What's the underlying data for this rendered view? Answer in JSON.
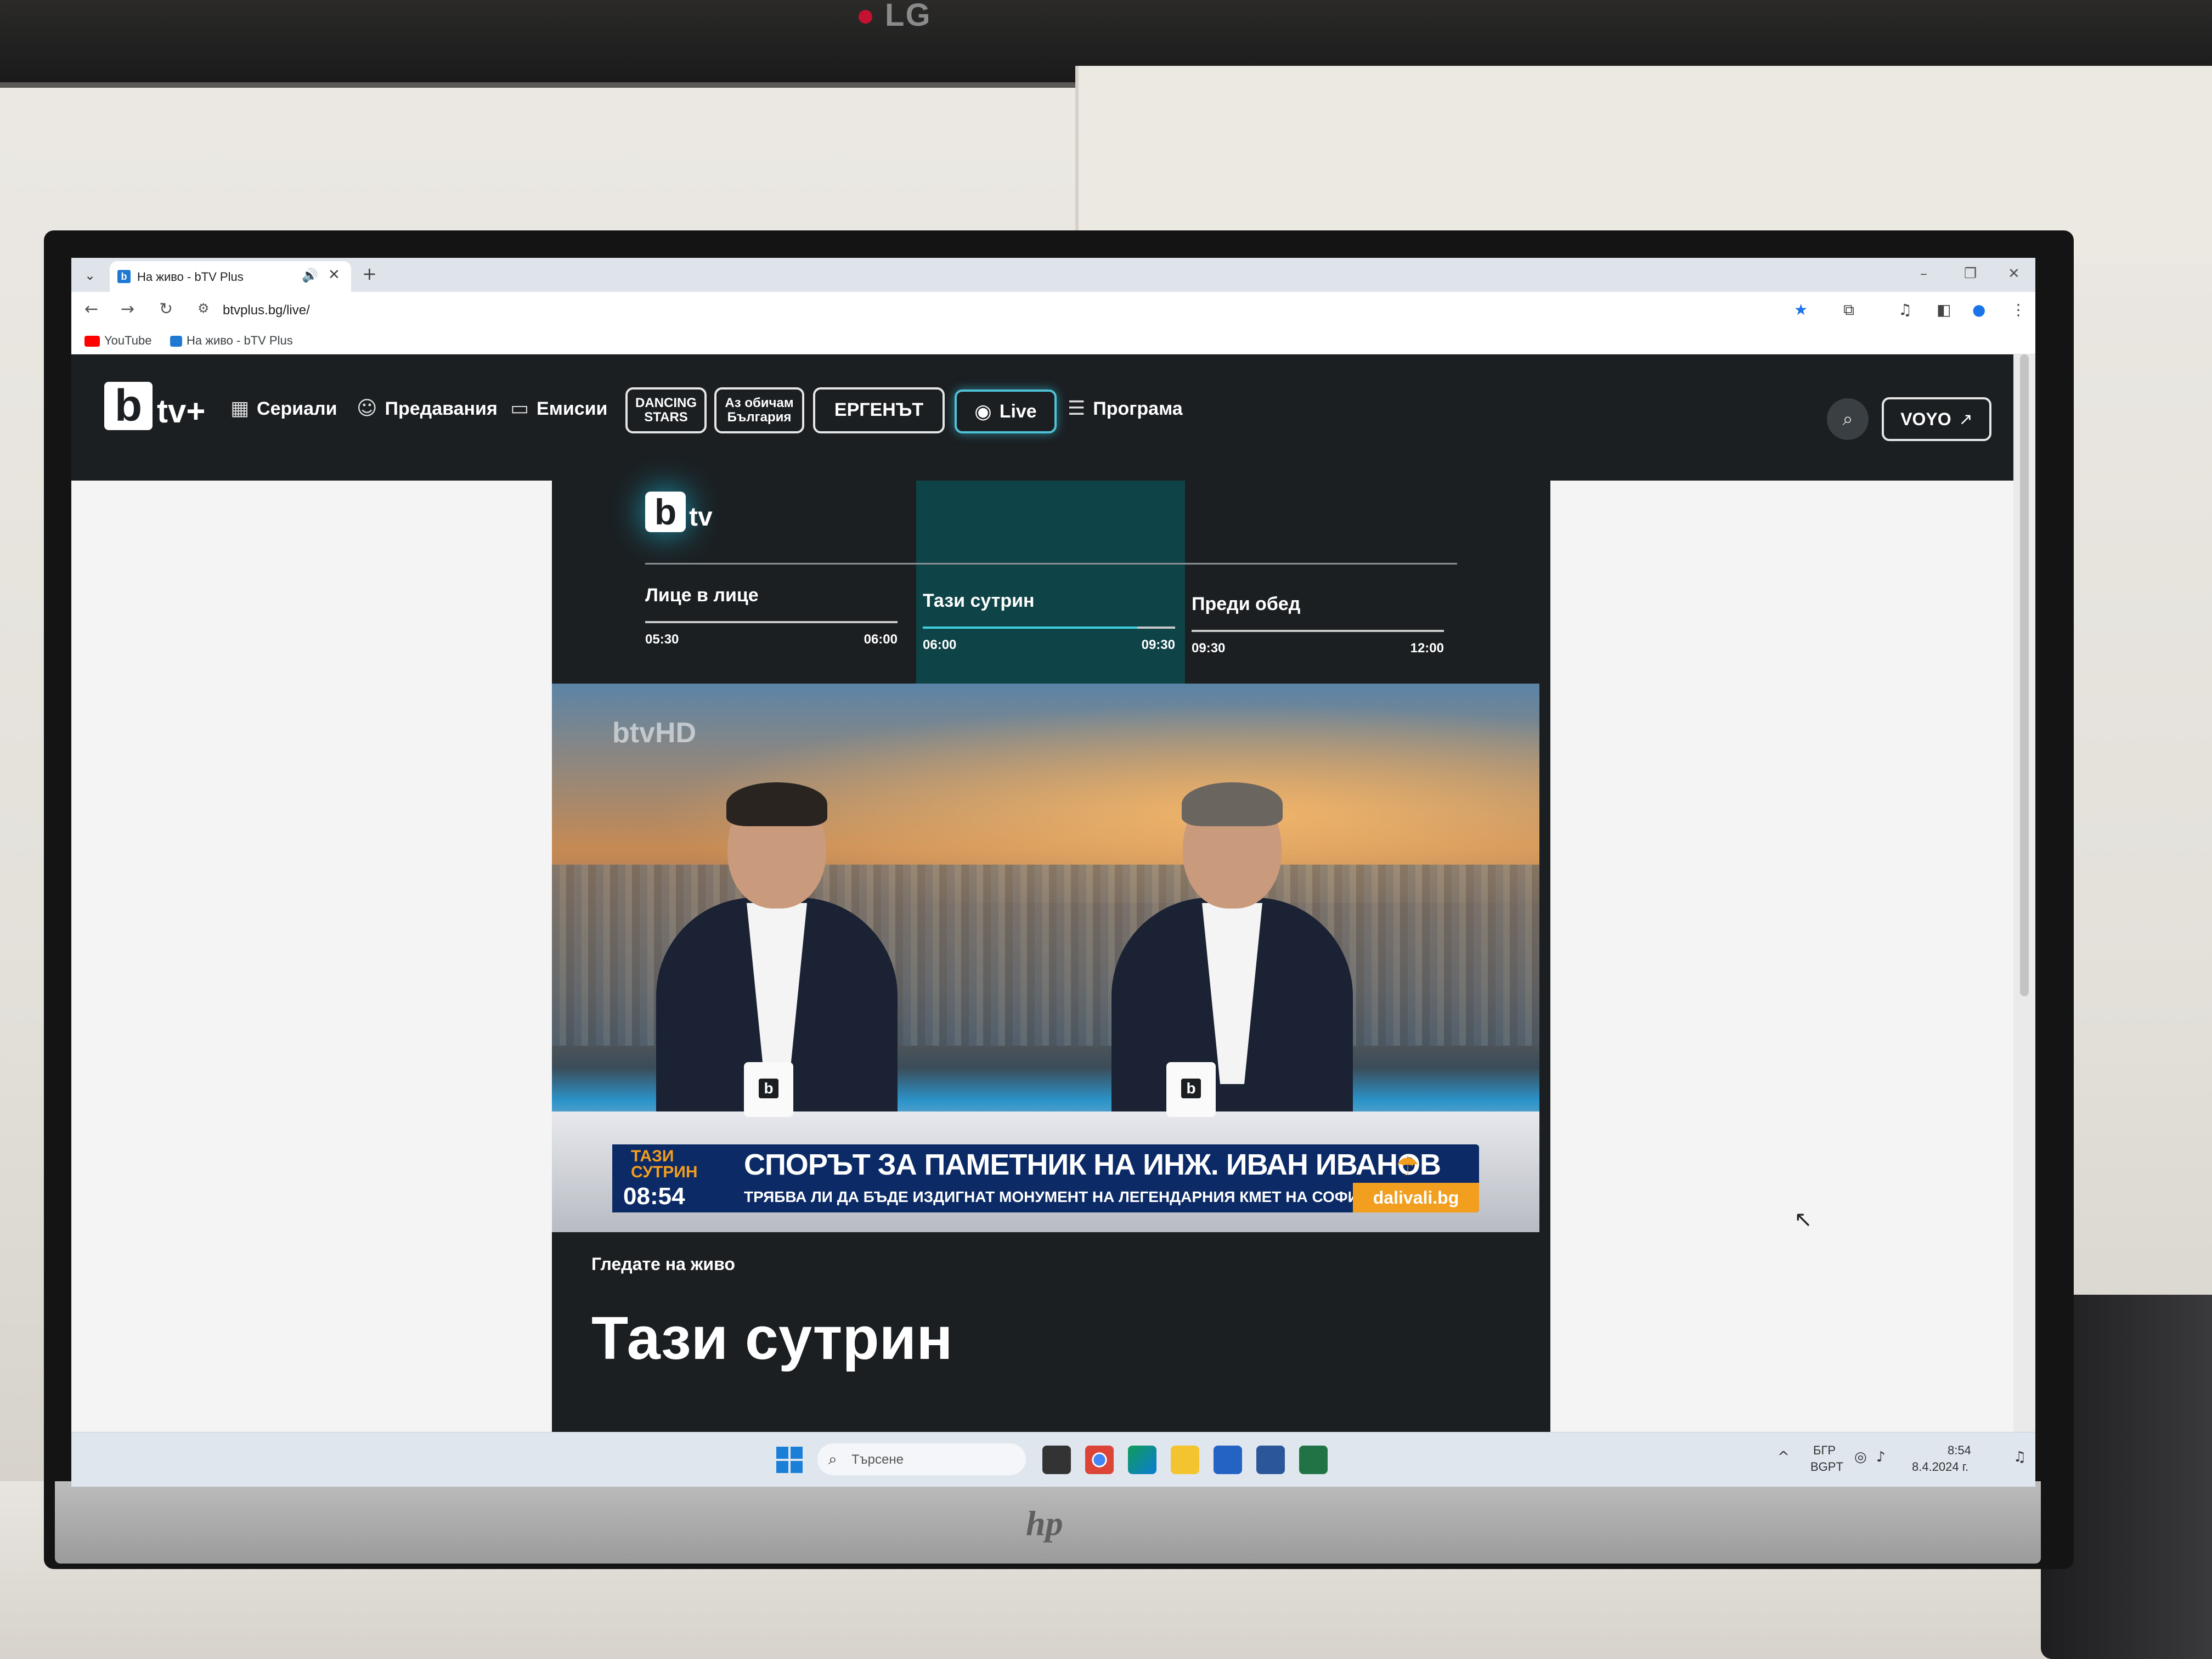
{
  "physical": {
    "lg_brand": "LG",
    "hp_brand": "hp"
  },
  "browser": {
    "tab_list_icon": "chevron-down-icon",
    "tab_title": "На живо - bTV Plus",
    "tab_favicon": "b",
    "tab_audio_icon": "speaker-icon",
    "url": "btvplus.bg/live/",
    "bookmarks": [
      {
        "label": "YouTube"
      },
      {
        "label": "На живо - bTV Plus"
      }
    ],
    "window_controls": [
      "–",
      "❐",
      "✕"
    ]
  },
  "site": {
    "logo_b": "b",
    "logo_text": "tv+",
    "nav": [
      {
        "label": "Сериали",
        "icon": "film-icon"
      },
      {
        "label": "Предавания",
        "icon": "mask-icon"
      },
      {
        "label": "Емисии",
        "icon": "monitor-icon"
      }
    ],
    "badges": [
      {
        "label": "DANCING STARS"
      },
      {
        "label": "Аз обичам България"
      },
      {
        "label": "ЕРГЕНЪТ"
      }
    ],
    "live_label": "Live",
    "program_label": "Програма",
    "voyo_label": "VOYO",
    "accent_color": "#4fc3d8"
  },
  "epg": {
    "channel_b": "b",
    "channel_text": "tv",
    "programs": [
      {
        "title": "Лице в лице",
        "start": "05:30",
        "end": "06:00",
        "progress": 1.0
      },
      {
        "title": "Тази сутрин",
        "start": "06:00",
        "end": "09:30",
        "progress": 0.85,
        "current": true
      },
      {
        "title": "Преди обед",
        "start": "09:30",
        "end": "12:00",
        "progress": 0.0
      }
    ]
  },
  "video": {
    "watermark": "btvHD",
    "mug_logo": "b",
    "show_name": "ТАЗИ СУТРИН",
    "time": "08:54",
    "headline": "СПОРЪТ ЗА ПАМЕТНИК НА ИНЖ. ИВАН ИВАНОВ",
    "subheadline": "ТРЯБВА ЛИ ДА БЪДЕ ИЗДИГНАТ МОНУМЕНТ НА ЛЕГЕНДАРНИЯ КМЕТ НА СОФИЯ?",
    "sponsor": "dalivali.bg"
  },
  "live_info": {
    "watching_label": "Гледате на живо",
    "show_title": "Тази сутрин"
  },
  "taskbar": {
    "search_placeholder": "Търсене",
    "language": "БГР",
    "layout": "BGPT",
    "time": "8:54",
    "date": "8.4.2024 г."
  }
}
